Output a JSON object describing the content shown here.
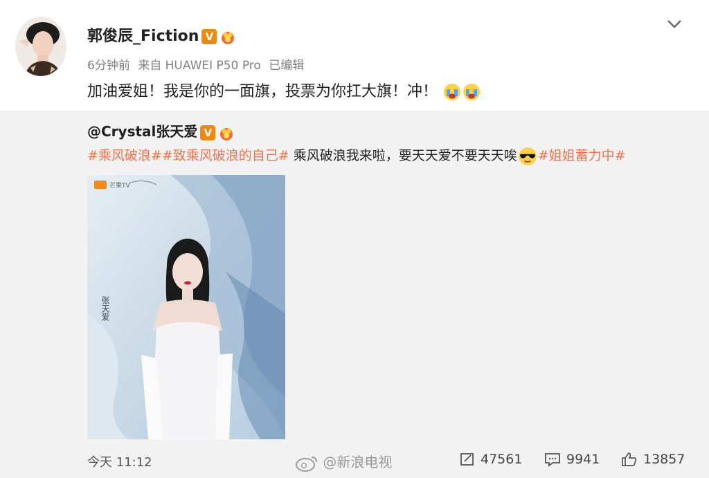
{
  "post": {
    "author": "郭俊辰_Fiction",
    "time_ago": "6分钟前",
    "source": "来自 HUAWEI P50 Pro",
    "edited": "已编辑",
    "content": "加油爱姐！我是你的一面旗，投票为你扛大旗！冲！"
  },
  "repost": {
    "author": "@Crystal张天爱",
    "tag1": "#乘风破浪#",
    "tag2": "#致乘风破浪的自己#",
    "text1": " 乘风破浪我来啦，要天天爱不要天天唉",
    "tag3": "#姐姐蓄力中#",
    "poster_logo_text": "芒果TV",
    "poster_name": "张天爱"
  },
  "footer": {
    "time": "今天 11:12",
    "watermark": "@新浪电视",
    "reposts": "47561",
    "comments": "9941",
    "likes": "13857"
  },
  "colors": {
    "tag": "#eb7350",
    "verified": "#ee8a12",
    "repost_bg": "#f2f2f2"
  },
  "icons": [
    "chevron-down-icon",
    "verified-v-icon",
    "crown-badge-icon",
    "crying-emoji-icon",
    "sunglasses-emoji-icon",
    "repost-icon",
    "comment-icon",
    "like-icon",
    "weibo-logo-icon"
  ]
}
